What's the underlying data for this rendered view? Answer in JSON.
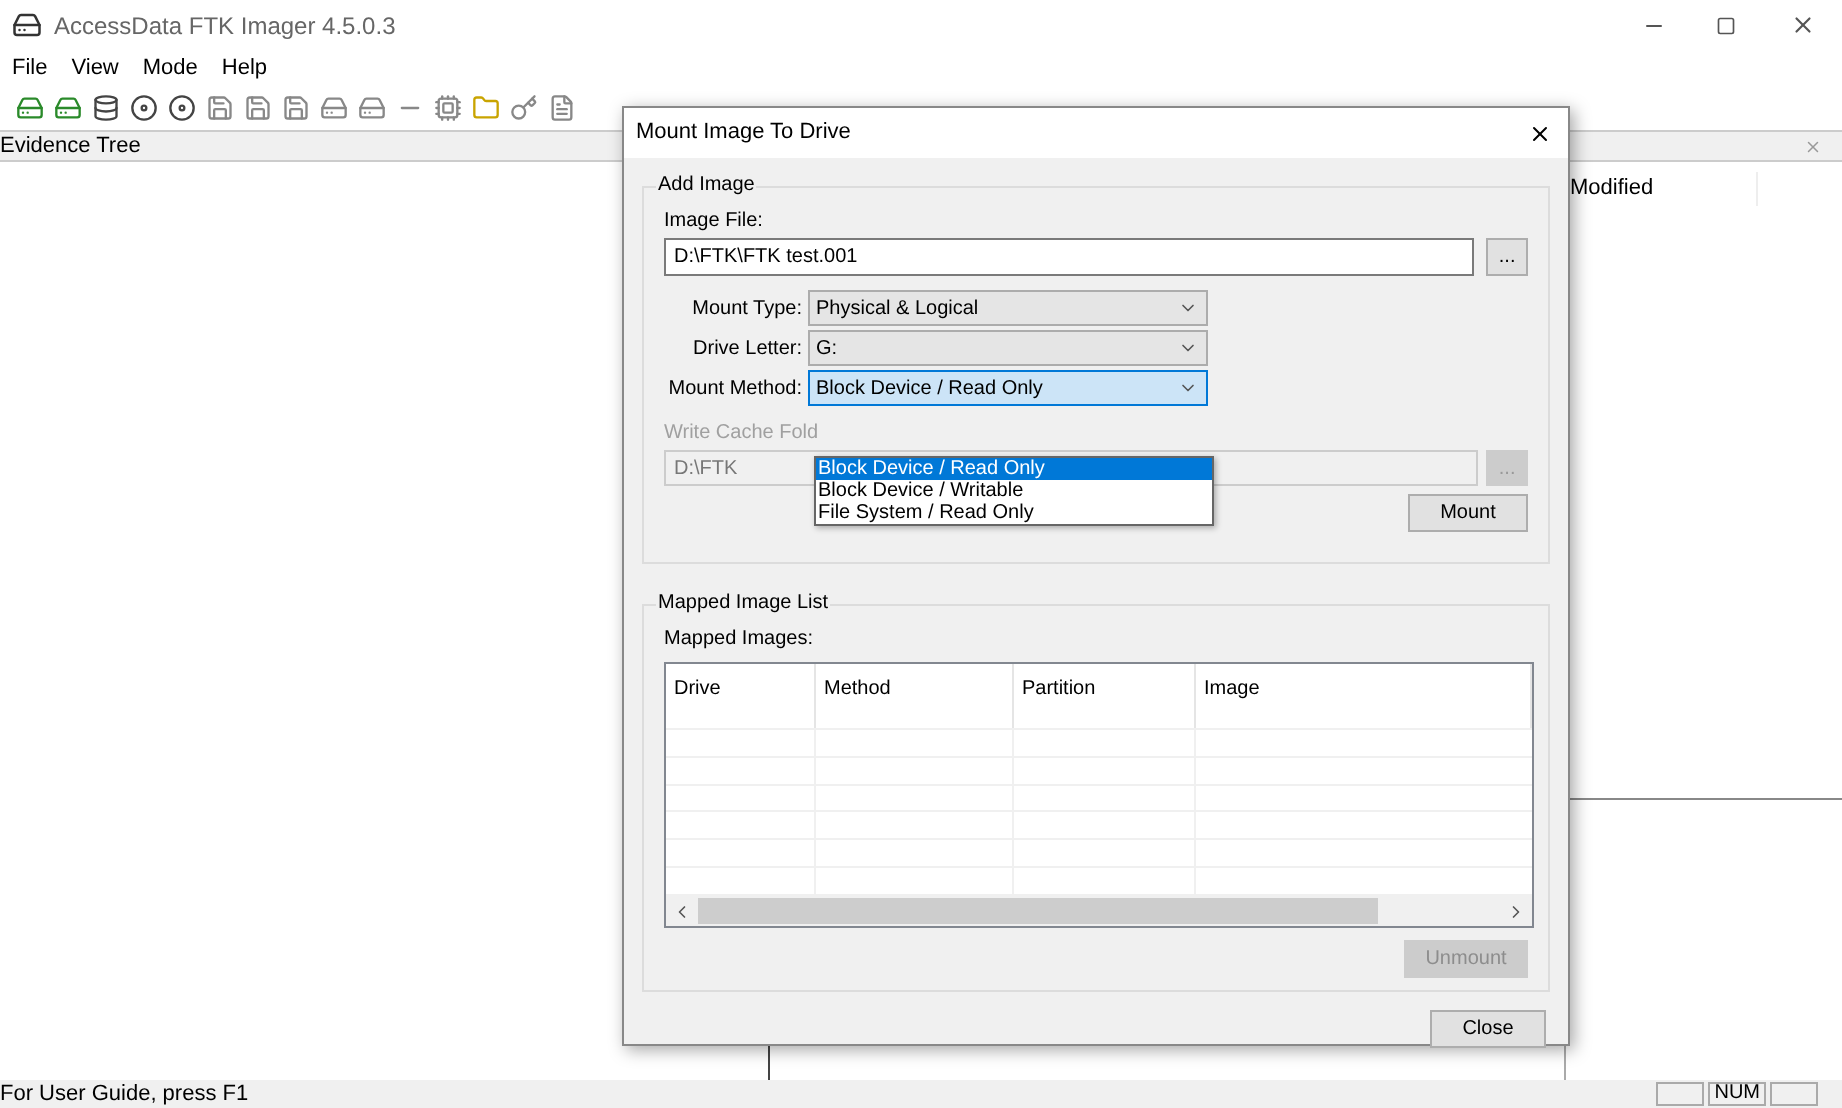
{
  "window": {
    "title": "AccessData FTK Imager 4.5.0.3"
  },
  "menu": [
    "File",
    "View",
    "Mode",
    "Help"
  ],
  "evidence_tree": {
    "title": "Evidence Tree"
  },
  "file_list": {
    "columns": [
      "Modified"
    ]
  },
  "status_bar": {
    "text": "For User Guide, press F1",
    "indicators": [
      "NUM"
    ]
  },
  "dialog": {
    "title": "Mount Image To Drive",
    "add_image": {
      "legend": "Add Image",
      "image_file_label": "Image File:",
      "image_file_value": "D:\\FTK\\FTK test.001",
      "browse": "...",
      "fields": [
        {
          "label": "Mount Type:",
          "value": "Physical & Logical",
          "expanded": false
        },
        {
          "label": "Drive Letter:",
          "value": "G:",
          "expanded": false
        },
        {
          "label": "Mount Method:",
          "value": "Block Device / Read Only",
          "expanded": true
        }
      ],
      "options": [
        {
          "label": "Block Device / Read Only",
          "selected": true
        },
        {
          "label": "Block Device / Writable",
          "selected": false
        },
        {
          "label": "File System / Read Only",
          "selected": false
        }
      ],
      "write_cache_label": "Write Cache Fold",
      "write_cache_value": "D:\\FTK",
      "write_cache_disabled": true,
      "write_cache_browse": "...",
      "mount_button": "Mount"
    },
    "mapped": {
      "legend": "Mapped Image List",
      "label": "Mapped Images:",
      "columns": [
        "Drive",
        "Method",
        "Partition",
        "Image"
      ],
      "unmount": {
        "label": "Unmount",
        "disabled": true
      },
      "close": "Close"
    }
  }
}
